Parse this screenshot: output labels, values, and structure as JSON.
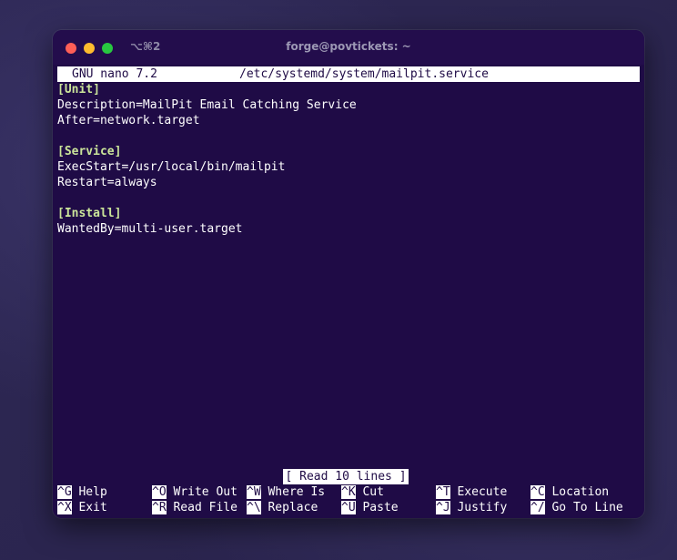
{
  "window": {
    "shortcut_hint": "⌥⌘2",
    "title": "forge@povtickets: ~"
  },
  "nano": {
    "version": "GNU nano 7.2",
    "file_path": "/etc/systemd/system/mailpit.service",
    "status": "[ Read 10 lines ]"
  },
  "file_lines": [
    {
      "text": "[Unit]",
      "section": true
    },
    {
      "text": "Description=MailPit Email Catching Service",
      "section": false
    },
    {
      "text": "After=network.target",
      "section": false
    },
    {
      "text": "",
      "section": false
    },
    {
      "text": "[Service]",
      "section": true
    },
    {
      "text": "ExecStart=/usr/local/bin/mailpit",
      "section": false
    },
    {
      "text": "Restart=always",
      "section": false
    },
    {
      "text": "",
      "section": false
    },
    {
      "text": "[Install]",
      "section": true
    },
    {
      "text": "WantedBy=multi-user.target",
      "section": false
    }
  ],
  "shortcuts": {
    "row1": [
      {
        "key": "^G",
        "label": "Help"
      },
      {
        "key": "^O",
        "label": "Write Out"
      },
      {
        "key": "^W",
        "label": "Where Is"
      },
      {
        "key": "^K",
        "label": "Cut"
      },
      {
        "key": "^T",
        "label": "Execute"
      },
      {
        "key": "^C",
        "label": "Location"
      }
    ],
    "row2": [
      {
        "key": "^X",
        "label": "Exit"
      },
      {
        "key": "^R",
        "label": "Read File"
      },
      {
        "key": "^\\",
        "label": "Replace"
      },
      {
        "key": "^U",
        "label": "Paste"
      },
      {
        "key": "^J",
        "label": "Justify"
      },
      {
        "key": "^/",
        "label": "Go To Line"
      }
    ]
  },
  "colors": {
    "terminal_bg": "#1f0b46",
    "section_header": "#cbe59a",
    "traffic_red": "#fe5f57",
    "traffic_yellow": "#febc2e",
    "traffic_green": "#28c840"
  }
}
